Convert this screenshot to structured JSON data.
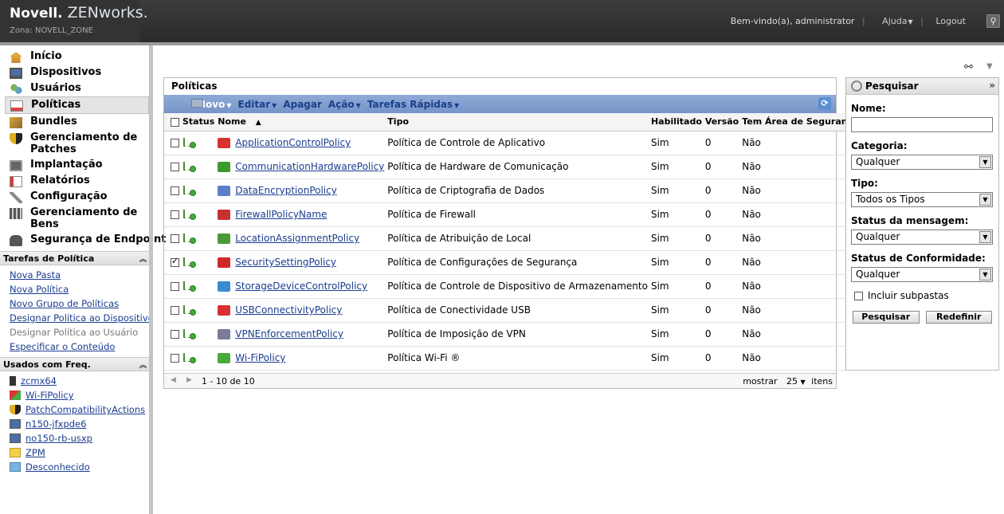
{
  "header": {
    "brand_novell": "Novell.",
    "brand_zen": "ZENworks.",
    "zone": "Zona: NOVELL_ZONE",
    "welcome": "Bem-vindo(a), administrator",
    "help": "Ajuda",
    "logout": "Logout"
  },
  "nav": {
    "items": [
      {
        "label": "Início"
      },
      {
        "label": "Dispositivos"
      },
      {
        "label": "Usuários"
      },
      {
        "label": "Políticas"
      },
      {
        "label": "Bundles"
      },
      {
        "label": "Gerenciamento de Patches"
      },
      {
        "label": "Implantação"
      },
      {
        "label": "Relatórios"
      },
      {
        "label": "Configuração"
      },
      {
        "label": "Gerenciamento de Bens"
      },
      {
        "label": "Segurança de Endpoint"
      }
    ]
  },
  "tasks": {
    "title": "Tarefas de Política",
    "items": [
      {
        "label": "Nova Pasta"
      },
      {
        "label": "Nova Política"
      },
      {
        "label": "Novo Grupo de Políticas"
      },
      {
        "label": "Designar Política ao Dispositivo"
      },
      {
        "label": "Designar Política ao Usuário"
      },
      {
        "label": "Especificar o Conteúdo"
      }
    ]
  },
  "freq": {
    "title": "Usados com Freq.",
    "items": [
      {
        "label": "zcmx64"
      },
      {
        "label": "Wi-FiPolicy"
      },
      {
        "label": "PatchCompatibilityActions"
      },
      {
        "label": "n150-jfxpde6"
      },
      {
        "label": "no150-rb-usxp"
      },
      {
        "label": "ZPM"
      },
      {
        "label": "Desconhecido"
      }
    ]
  },
  "panel": {
    "title": "Políticas",
    "toolbar": {
      "novo": "Novo",
      "editar": "Editar",
      "apagar": "Apagar",
      "acao": "Ação",
      "tarefas": "Tarefas Rápidas"
    },
    "columns": {
      "status": "Status",
      "nome": "Nome",
      "tipo": "Tipo",
      "habilitado": "Habilitado",
      "versao": "Versão",
      "area": "Tem Área de Segurança"
    },
    "rows": [
      {
        "name": "ApplicationControlPolicy",
        "type": "Política de Controle de Aplicativo",
        "enabled": "Sim",
        "version": "0",
        "area": "Não",
        "checked": false,
        "color": "#d93030"
      },
      {
        "name": "CommunicationHardwarePolicy",
        "type": "Política de Hardware de Comunicação",
        "enabled": "Sim",
        "version": "0",
        "area": "Não",
        "checked": false,
        "color": "#3a9a2e"
      },
      {
        "name": "DataEncryptionPolicy",
        "type": "Política de Criptografia de Dados",
        "enabled": "Sim",
        "version": "0",
        "area": "Não",
        "checked": false,
        "color": "#5a7fc8"
      },
      {
        "name": "FirewallPolicyName",
        "type": "Política de Firewall",
        "enabled": "Sim",
        "version": "0",
        "area": "Não",
        "checked": false,
        "color": "#c83030"
      },
      {
        "name": "LocationAssignmentPolicy",
        "type": "Política de Atribuição de Local",
        "enabled": "Sim",
        "version": "0",
        "area": "Não",
        "checked": false,
        "color": "#4a9a3a"
      },
      {
        "name": "SecuritySettingPolicy",
        "type": "Política de Configurações de Segurança",
        "enabled": "Sim",
        "version": "0",
        "area": "Não",
        "checked": true,
        "color": "#d02828"
      },
      {
        "name": "StorageDeviceControlPolicy",
        "type": "Política de Controle de Dispositivo de Armazenamento",
        "enabled": "Sim",
        "version": "0",
        "area": "Não",
        "checked": false,
        "color": "#3a8ad0"
      },
      {
        "name": "USBConnectivityPolicy",
        "type": "Política de Conectividade USB",
        "enabled": "Sim",
        "version": "0",
        "area": "Não",
        "checked": false,
        "color": "#d83030"
      },
      {
        "name": "VPNEnforcementPolicy",
        "type": "Política de Imposição de VPN",
        "enabled": "Sim",
        "version": "0",
        "area": "Não",
        "checked": false,
        "color": "#7a7a9a"
      },
      {
        "name": "Wi-FiPolicy",
        "type": "Política Wi-Fi ®",
        "enabled": "Sim",
        "version": "0",
        "area": "Não",
        "checked": false,
        "color": "#4aaa3a"
      }
    ],
    "pager": {
      "range": "1 - 10 de 10",
      "show": "mostrar",
      "count": "25",
      "items": "itens"
    }
  },
  "search": {
    "title": "Pesquisar",
    "name_label": "Nome:",
    "category_label": "Categoria:",
    "category_value": "Qualquer",
    "type_label": "Tipo:",
    "type_value": "Todos os Tipos",
    "msg_label": "Status da mensagem:",
    "msg_value": "Qualquer",
    "conf_label": "Status de Conformidade:",
    "conf_value": "Qualquer",
    "subfolders": "Incluir subpastas",
    "search_btn": "Pesquisar",
    "reset_btn": "Redefinir"
  }
}
